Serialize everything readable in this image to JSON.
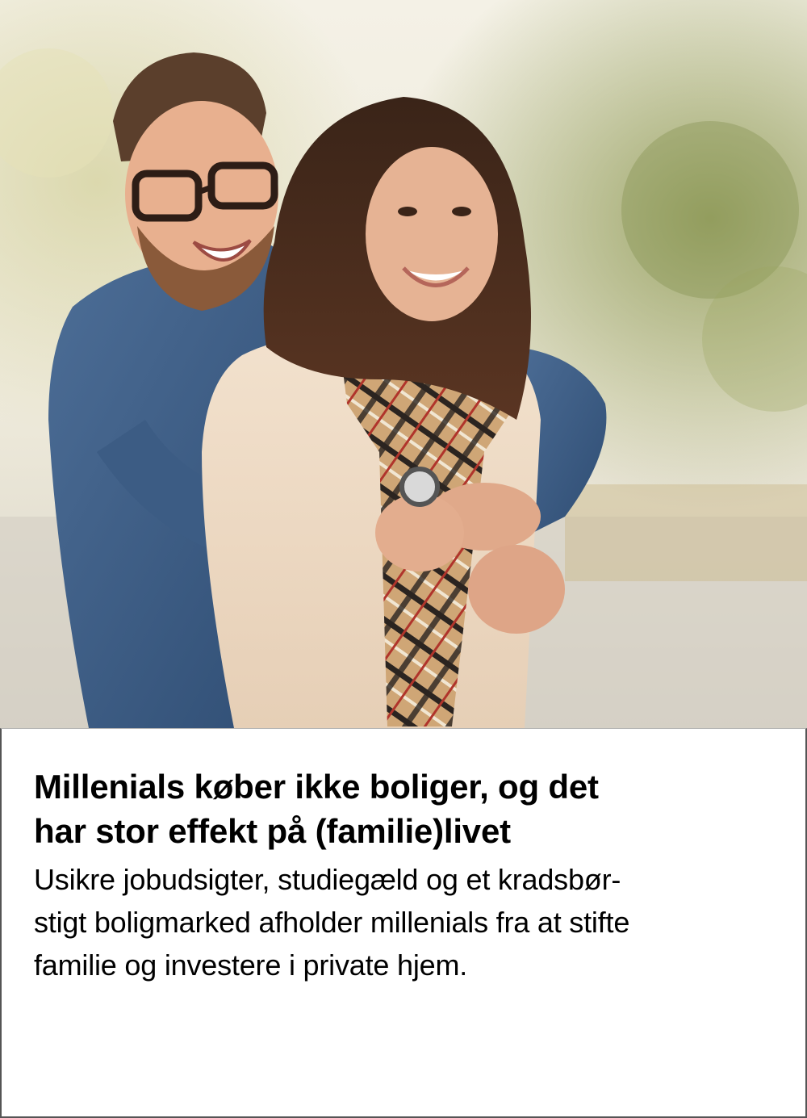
{
  "article": {
    "image": {
      "subject": "smiling couple embracing outdoors"
    },
    "headline_line1": "Millenials køber ikke boliger, og det",
    "headline_line2": "har stor effekt på (familie)livet",
    "summary_line1": "Usikre jobudsigter, studiegæld og et kradsbør-",
    "summary_line2": "stigt boligmarked afholder millenials fra at stifte",
    "summary_line3": "familie og investere i private hjem."
  },
  "colors": {
    "text": "#000000",
    "background": "#ffffff",
    "border": "#555555"
  }
}
